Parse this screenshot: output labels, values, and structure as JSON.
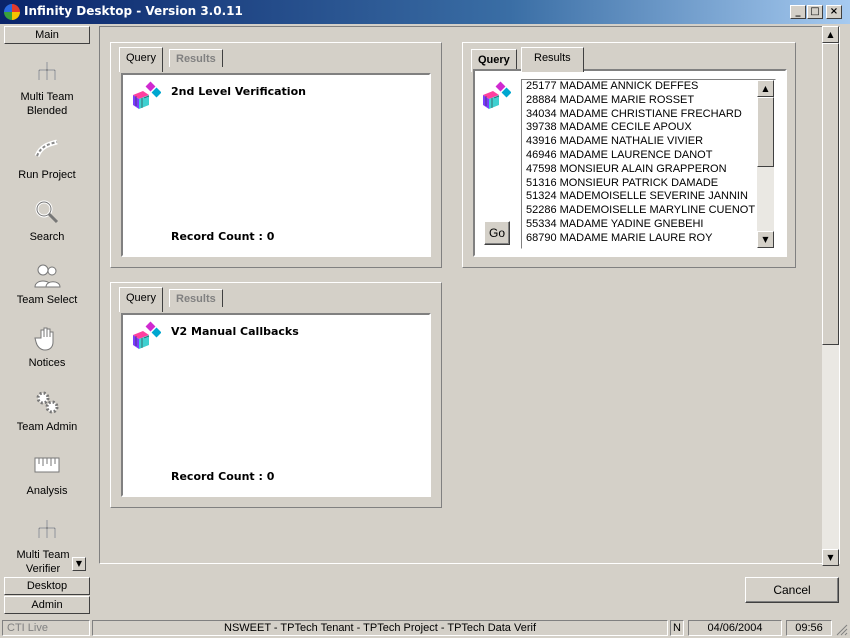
{
  "window": {
    "title": "Infinity Desktop - Version 3.0.11",
    "minimize": "_",
    "maximize": "□",
    "close": "×"
  },
  "nav": {
    "top_tab": "Main",
    "items": [
      {
        "label": "Multi Team Blended",
        "icon": "hierarchy-icon"
      },
      {
        "label": "Run Project",
        "icon": "run-project-icon"
      },
      {
        "label": "Search",
        "icon": "magnifier-icon"
      },
      {
        "label": "Team Select",
        "icon": "team-icon"
      },
      {
        "label": "Notices",
        "icon": "hand-icon"
      },
      {
        "label": "Team Admin",
        "icon": "gears-icon"
      },
      {
        "label": "Analysis",
        "icon": "analysis-icon"
      },
      {
        "label": "Multi Team Verifier",
        "icon": "hierarchy-icon"
      }
    ],
    "bottom_tabs": [
      "Desktop",
      "Admin"
    ]
  },
  "panels": {
    "p1": {
      "tab_query": "Query",
      "tab_results": "Results",
      "title": "2nd Level Verification",
      "record_count": "Record Count : 0"
    },
    "p2": {
      "tab_query": "Query",
      "tab_results": "Results",
      "go_label": "Go",
      "results": [
        "25177 MADAME ANNICK DEFFES",
        "28884 MADAME MARIE ROSSET",
        "34034 MADAME CHRISTIANE FRECHARD",
        "39738 MADAME CECILE APOUX",
        "43916 MADAME NATHALIE VIVIER",
        "46946 MADAME LAURENCE DANOT",
        "47598 MONSIEUR ALAIN GRAPPERON",
        "51316 MONSIEUR PATRICK DAMADE",
        "51324 MADEMOISELLE SEVERINE JANNIN",
        "52286 MADEMOISELLE MARYLINE CUENOT",
        "55334 MADAME YADINE GNEBEHI",
        "68790 MADAME MARIE LAURE ROY"
      ]
    },
    "p3": {
      "tab_query": "Query",
      "tab_results": "Results",
      "title": "V2 Manual Callbacks",
      "record_count": "Record Count : 0"
    }
  },
  "footer": {
    "cancel_label": "Cancel"
  },
  "status": {
    "cti": "CTI Live",
    "session": "NSWEET - TPTech Tenant - TPTech Project - TPTech Data Verif",
    "flag": "N",
    "date": "04/06/2004",
    "time": "09:56"
  }
}
